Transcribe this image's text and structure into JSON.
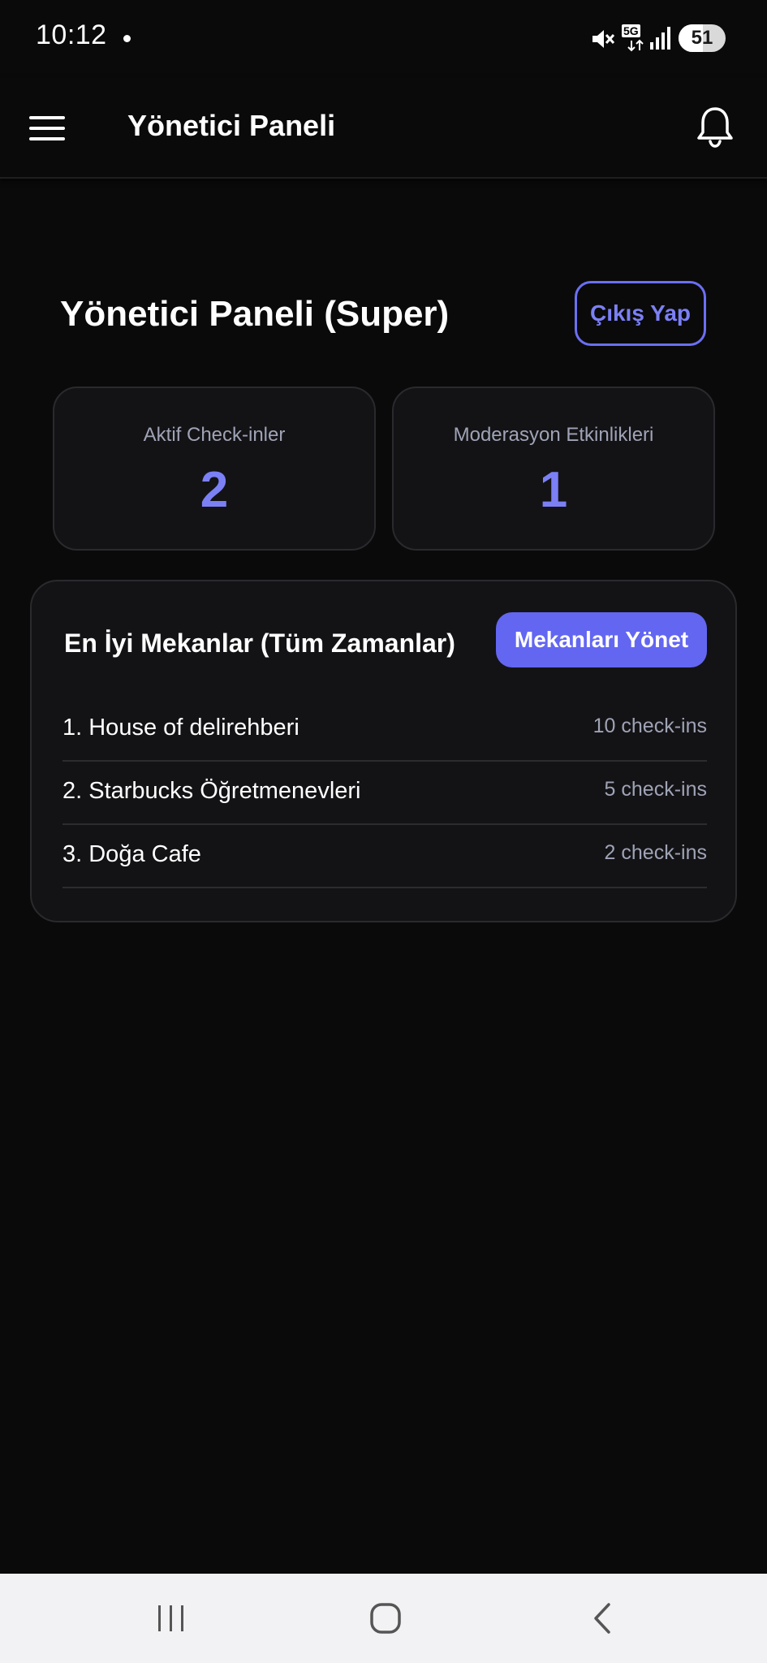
{
  "status_bar": {
    "time": "10:12",
    "network_label": "5G",
    "battery_label": "51",
    "battery_level": 0.51
  },
  "app_bar": {
    "title": "Yönetici Paneli",
    "menu_icon": "hamburger-menu-icon",
    "bell_icon": "bell-icon"
  },
  "header": {
    "title": "Yönetici Paneli (Super)",
    "logout_label": "Çıkış Yap"
  },
  "stats": [
    {
      "label": "Aktif Check-inler",
      "value": "2"
    },
    {
      "label": "Moderasyon Etkinlikleri",
      "value": "1"
    }
  ],
  "venues": {
    "title": "En İyi Mekanlar (Tüm Zamanlar)",
    "manage_label": "Mekanları Yönet",
    "items": [
      {
        "name": "1. House of delirehberi",
        "count": "10 check-ins"
      },
      {
        "name": "2. Starbucks Öğretmenevleri",
        "count": "5 check-ins"
      },
      {
        "name": "3. Doğa Cafe",
        "count": "2 check-ins"
      }
    ]
  },
  "colors": {
    "accent": "#6366f1",
    "accent_text": "#7c80f5",
    "background": "#0a0a0b",
    "card": "#131316",
    "muted_text": "#9fa3b5"
  },
  "nav_bar": {
    "icons": [
      "recents-icon",
      "home-icon",
      "back-icon"
    ]
  }
}
